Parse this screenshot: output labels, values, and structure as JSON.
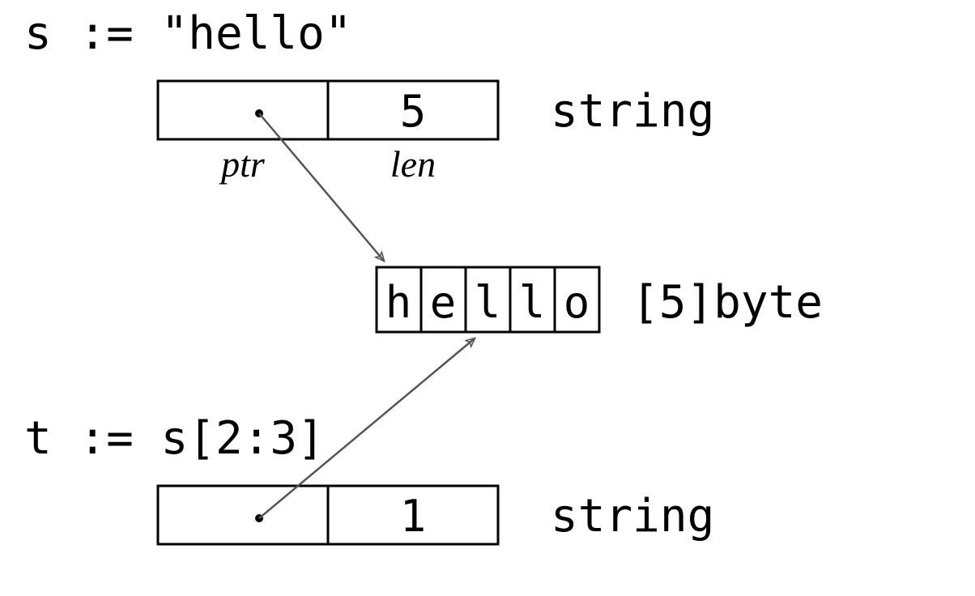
{
  "s_decl": "s := \"hello\"",
  "t_decl": "t := s[2:3]",
  "type_label_string": "string",
  "type_label_bytes": "[5]byte",
  "s_header": {
    "len": "5"
  },
  "t_header": {
    "len": "1"
  },
  "field_labels": {
    "ptr": "ptr",
    "len": "len"
  },
  "bytes": [
    "h",
    "e",
    "l",
    "l",
    "o"
  ]
}
